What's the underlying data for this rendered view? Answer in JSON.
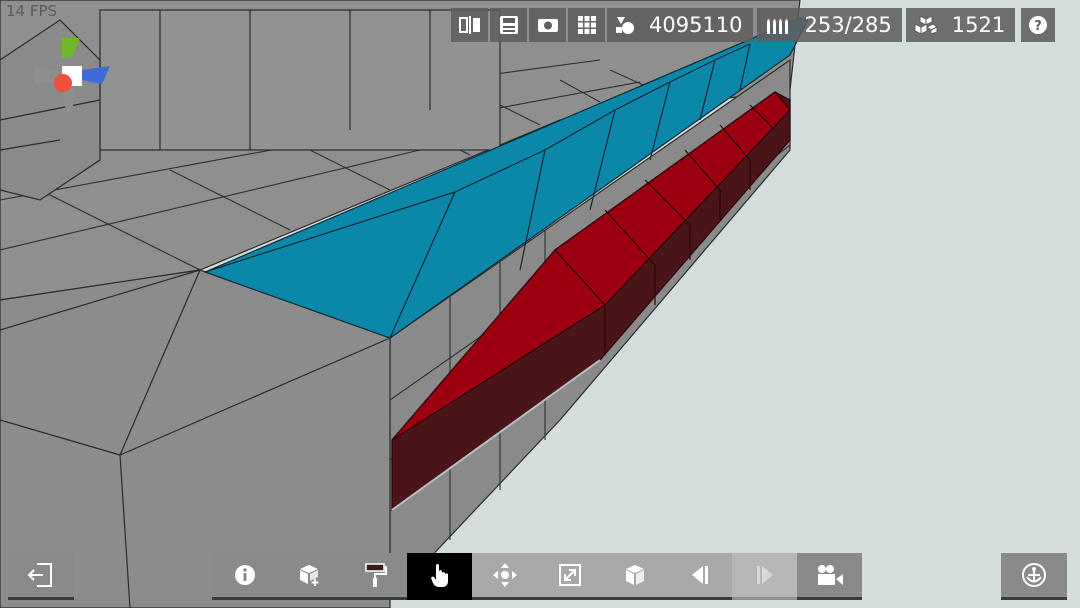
{
  "hud": {
    "fps": "14 FPS",
    "polygons": "4095110",
    "ammo": "253/285",
    "blocks": "1521"
  },
  "icons": {
    "top": [
      "mirror-icon",
      "save-icon",
      "camera-icon",
      "grid-icon",
      "polygons-icon",
      "ammo-icon",
      "blocks-icon",
      "help-icon"
    ],
    "bottom": [
      "exit-icon",
      "info-icon",
      "add-block-icon",
      "paint-roller-icon",
      "hand-select-icon",
      "move-icon",
      "resize-icon",
      "block-icon",
      "undo-icon",
      "redo-icon",
      "camera-view-icon",
      "anchor-icon"
    ]
  },
  "colors": {
    "background": "#d3dedc",
    "hull": "#8c8c8c",
    "selection_blue": "#0b87aa",
    "selection_red": "#9c0010"
  }
}
